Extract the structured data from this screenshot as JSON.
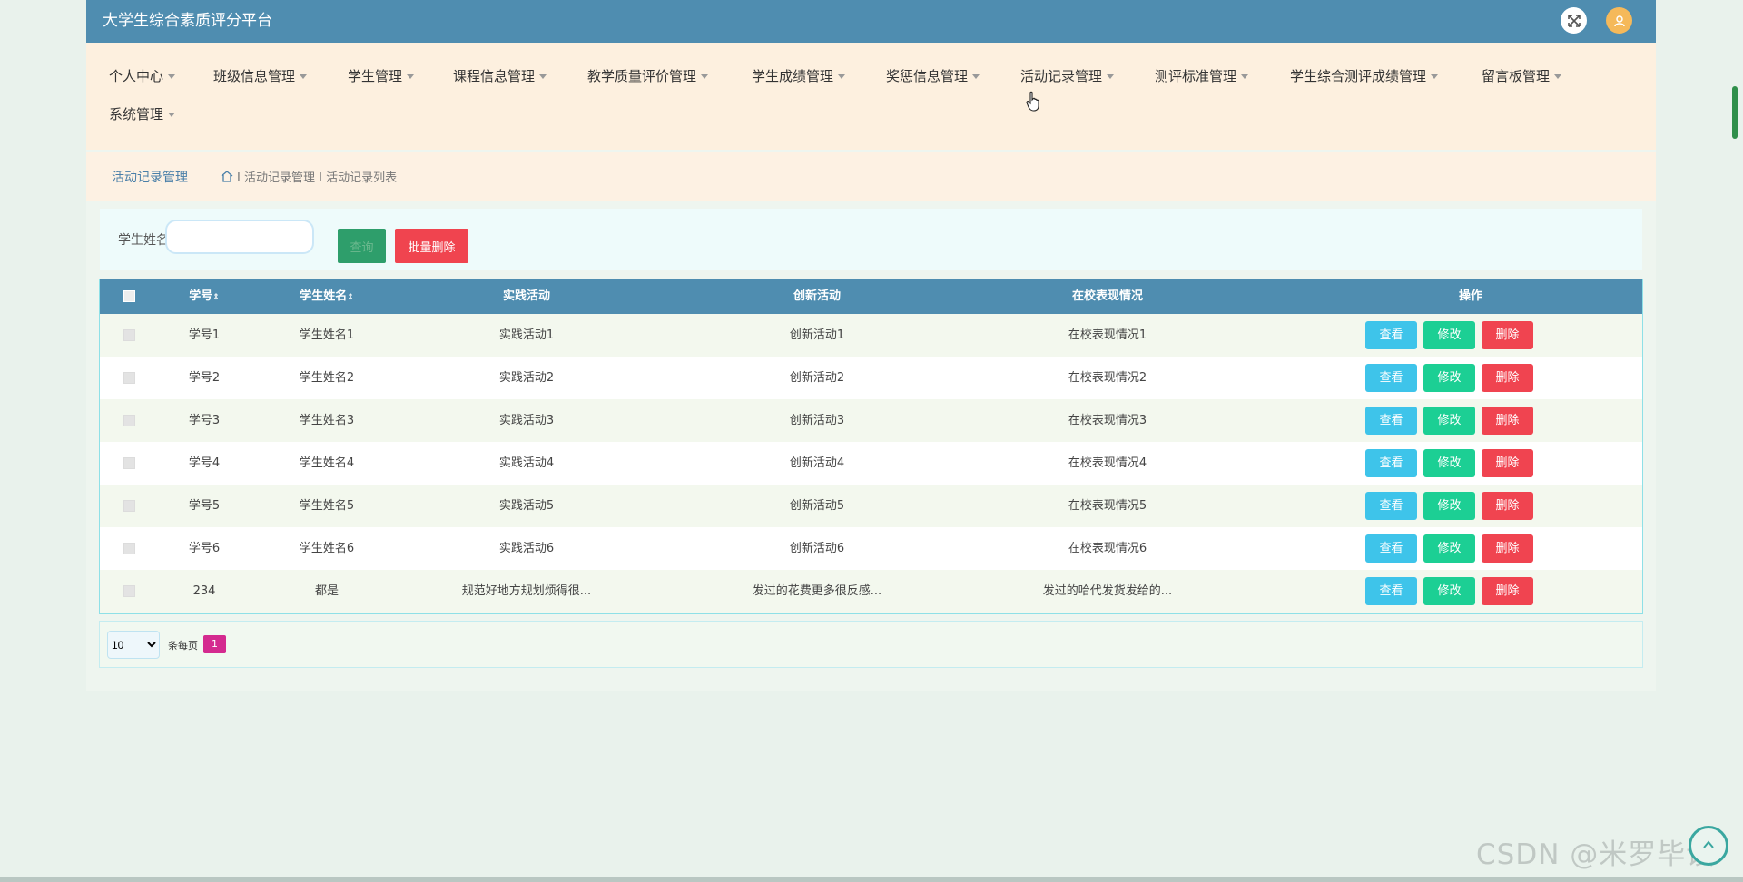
{
  "app": {
    "title": "大学生综合素质评分平台"
  },
  "header": {
    "fullscreen_icon": "expand-icon",
    "user_icon": "user-avatar-icon",
    "accent_color": "#4f8db0"
  },
  "nav": {
    "items": [
      {
        "label": "个人中心"
      },
      {
        "label": "班级信息管理"
      },
      {
        "label": "学生管理"
      },
      {
        "label": "课程信息管理"
      },
      {
        "label": "教学质量评价管理"
      },
      {
        "label": "学生成绩管理"
      },
      {
        "label": "奖惩信息管理"
      },
      {
        "label": "活动记录管理"
      },
      {
        "label": "测评标准管理"
      },
      {
        "label": "学生综合测评成绩管理"
      },
      {
        "label": "留言板管理"
      },
      {
        "label": "系统管理"
      }
    ]
  },
  "breadcrumb": {
    "title": "活动记录管理",
    "home_icon": "home-icon",
    "path": "I 活动记录管理 I 活动记录列表"
  },
  "search": {
    "label": "学生姓名",
    "value": "",
    "search_button": "查询",
    "batch_delete_button": "批量删除"
  },
  "table": {
    "columns": [
      "学号",
      "学生姓名",
      "实践活动",
      "创新活动",
      "在校表现情况",
      "操作"
    ],
    "sort_glyph": "⇕",
    "rows": [
      {
        "id": "学号1",
        "name": "学生姓名1",
        "practice": "实践活动1",
        "innovation": "创新活动1",
        "performance": "在校表现情况1"
      },
      {
        "id": "学号2",
        "name": "学生姓名2",
        "practice": "实践活动2",
        "innovation": "创新活动2",
        "performance": "在校表现情况2"
      },
      {
        "id": "学号3",
        "name": "学生姓名3",
        "practice": "实践活动3",
        "innovation": "创新活动3",
        "performance": "在校表现情况3"
      },
      {
        "id": "学号4",
        "name": "学生姓名4",
        "practice": "实践活动4",
        "innovation": "创新活动4",
        "performance": "在校表现情况4"
      },
      {
        "id": "学号5",
        "name": "学生姓名5",
        "practice": "实践活动5",
        "innovation": "创新活动5",
        "performance": "在校表现情况5"
      },
      {
        "id": "学号6",
        "name": "学生姓名6",
        "practice": "实践活动6",
        "innovation": "创新活动6",
        "performance": "在校表现情况6"
      },
      {
        "id": "234",
        "name": "都是",
        "practice": "规范好地方规划烦得很...",
        "innovation": "发过的花费更多很反感...",
        "performance": "发过的哈代发货发给的..."
      }
    ],
    "actions": {
      "view": "查看",
      "edit": "修改",
      "delete": "删除"
    }
  },
  "pagination": {
    "page_size": "10",
    "per_page_label": "条每页",
    "current_page": "1"
  },
  "watermark": "CSDN @米罗毕设"
}
